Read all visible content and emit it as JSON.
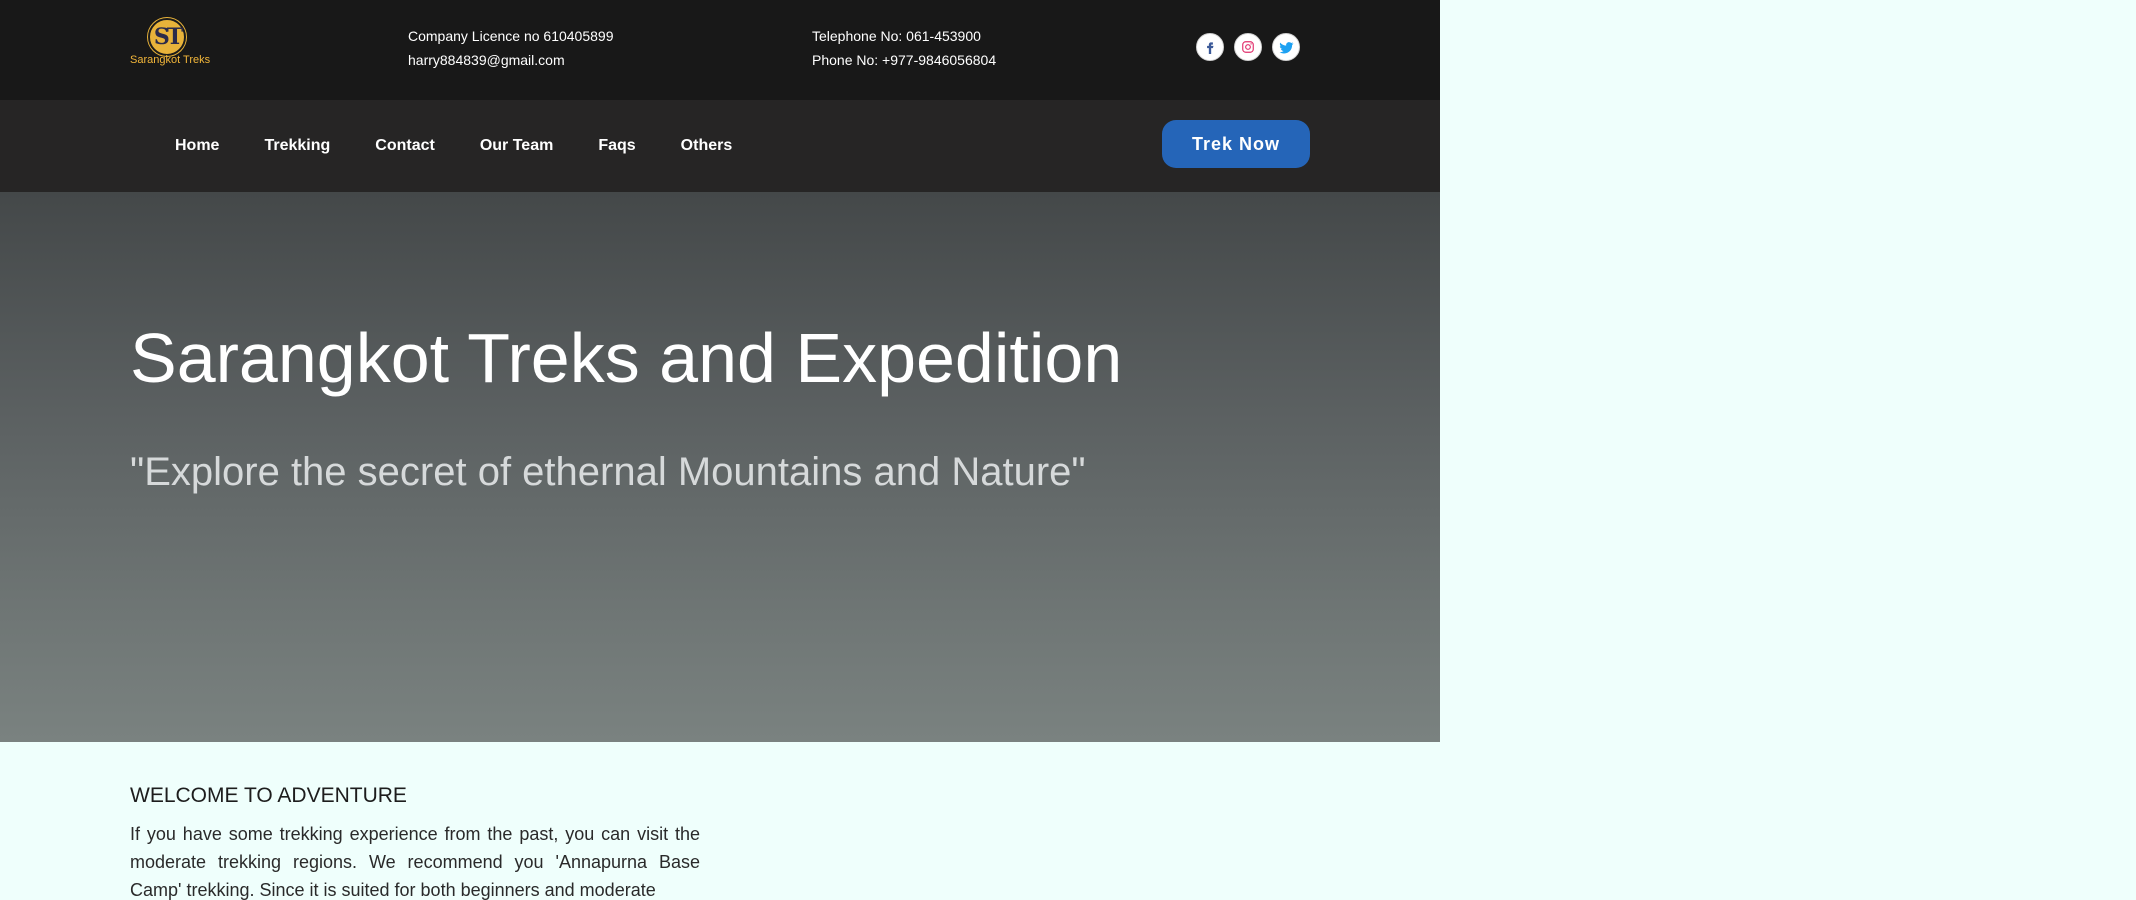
{
  "logo": {
    "letters": "ST",
    "name": "Sarangkot Treks"
  },
  "contact": {
    "licence": "Company Licence no 610405899",
    "email": "harry884839@gmail.com",
    "telephone": "Telephone No: 061-453900",
    "phone": "Phone No: +977-9846056804"
  },
  "social": [
    {
      "name": "facebook",
      "icon": "facebook-icon",
      "color": "#3b5998"
    },
    {
      "name": "instagram",
      "icon": "instagram-icon",
      "color": "#e1306c"
    },
    {
      "name": "twitter",
      "icon": "twitter-icon",
      "color": "#1da1f2"
    }
  ],
  "nav": {
    "items": [
      "Home",
      "Trekking",
      "Contact",
      "Our Team",
      "Faqs",
      "Others"
    ],
    "cta": "Trek Now"
  },
  "hero": {
    "title": "Sarangkot Treks and Expedition",
    "subtitle": "\"Explore the secret of ethernal Mountains and Nature\""
  },
  "welcome": {
    "title": "WELCOME TO ADVENTURE",
    "text": "If you have some trekking experience from the past, you can visit the moderate trekking regions. We recommend you 'Annapurna Base Camp' trekking. Since it is suited for both beginners and moderate"
  },
  "colors": {
    "accent": "#2565b8",
    "logo_gold": "#e8b33a",
    "topbar": "#181818",
    "navbar": "#262525",
    "page_bg": "#effffc"
  }
}
